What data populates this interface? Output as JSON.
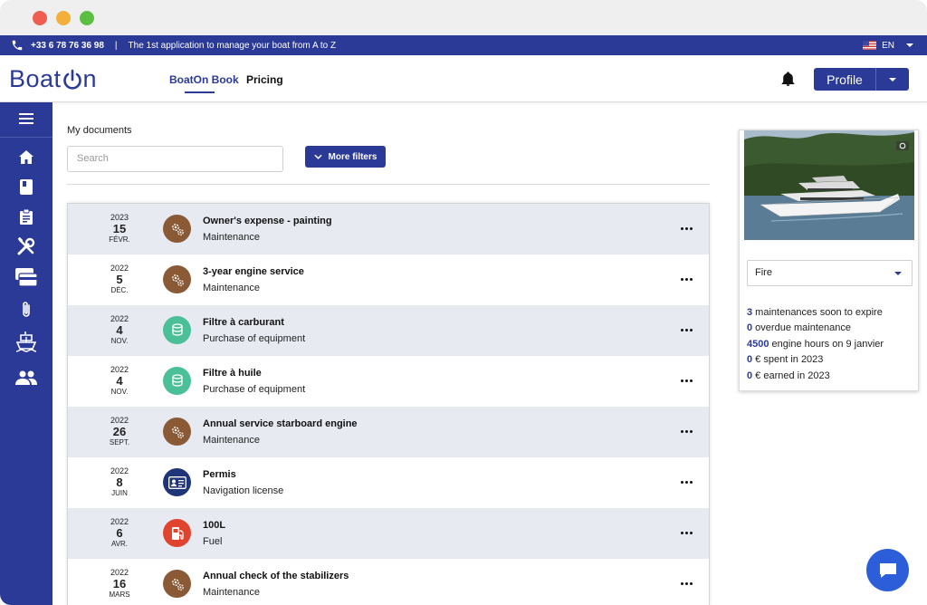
{
  "topbar": {
    "phone": "+33 6 78 76 36 98",
    "separator": "|",
    "tagline": "The 1st application to manage your boat from A to Z",
    "language": "EN"
  },
  "header": {
    "logo": "BoatOn",
    "nav": [
      "BoatOn Book",
      "Pricing"
    ],
    "active_nav": "BoatOn Book",
    "profile_label": "Profile"
  },
  "sidebar": {
    "items": [
      "menu-icon",
      "home-icon",
      "book-icon",
      "clipboard-icon",
      "tools-icon",
      "credit-card-icon",
      "paperclip-icon",
      "ship-icon",
      "users-icon"
    ]
  },
  "main": {
    "title": "My documents",
    "search_placeholder": "Search",
    "filters_label": "More filters",
    "documents": [
      {
        "year": "2023",
        "day": "15",
        "month": "FÉVR.",
        "icon": "gears-icon",
        "title": "Owner's expense - painting",
        "category": "Maintenance"
      },
      {
        "year": "2022",
        "day": "5",
        "month": "DÉC.",
        "icon": "gears-icon",
        "title": "3-year engine service",
        "category": "Maintenance"
      },
      {
        "year": "2022",
        "day": "4",
        "month": "NOV.",
        "icon": "coins-icon",
        "title": "Filtre à carburant",
        "category": "Purchase of equipment"
      },
      {
        "year": "2022",
        "day": "4",
        "month": "NOV.",
        "icon": "coins-icon",
        "title": "Filtre à huile",
        "category": "Purchase of equipment"
      },
      {
        "year": "2022",
        "day": "26",
        "month": "SEPT.",
        "icon": "gears-icon",
        "title": "Annual service starboard engine",
        "category": "Maintenance"
      },
      {
        "year": "2022",
        "day": "8",
        "month": "JUIN",
        "icon": "id-card-icon",
        "title": "Permis",
        "category": "Navigation license"
      },
      {
        "year": "2022",
        "day": "6",
        "month": "AVR.",
        "icon": "fuel-icon",
        "title": "100L",
        "category": "Fuel"
      },
      {
        "year": "2022",
        "day": "16",
        "month": "MARS",
        "icon": "gears-icon",
        "title": "Annual check of the stabilizers",
        "category": "Maintenance"
      }
    ]
  },
  "boat_card": {
    "selected_boat": "Fire",
    "stats": [
      {
        "value": "3",
        "text": " maintenances soon to expire"
      },
      {
        "value": "0",
        "text": " overdue maintenance"
      },
      {
        "value": "4500",
        "text": " engine hours on 9 janvier"
      },
      {
        "value": "0",
        "text": " € spent in 2023"
      },
      {
        "value": "0",
        "text": " € earned in 2023"
      }
    ]
  },
  "colors": {
    "brand": "#2b3a96",
    "maintenance_icon": "#8a5a36",
    "equipment_icon": "#4bbf97",
    "license_icon": "#1f3577",
    "fuel_icon": "#e0442f",
    "chat": "#2b5ed8"
  }
}
